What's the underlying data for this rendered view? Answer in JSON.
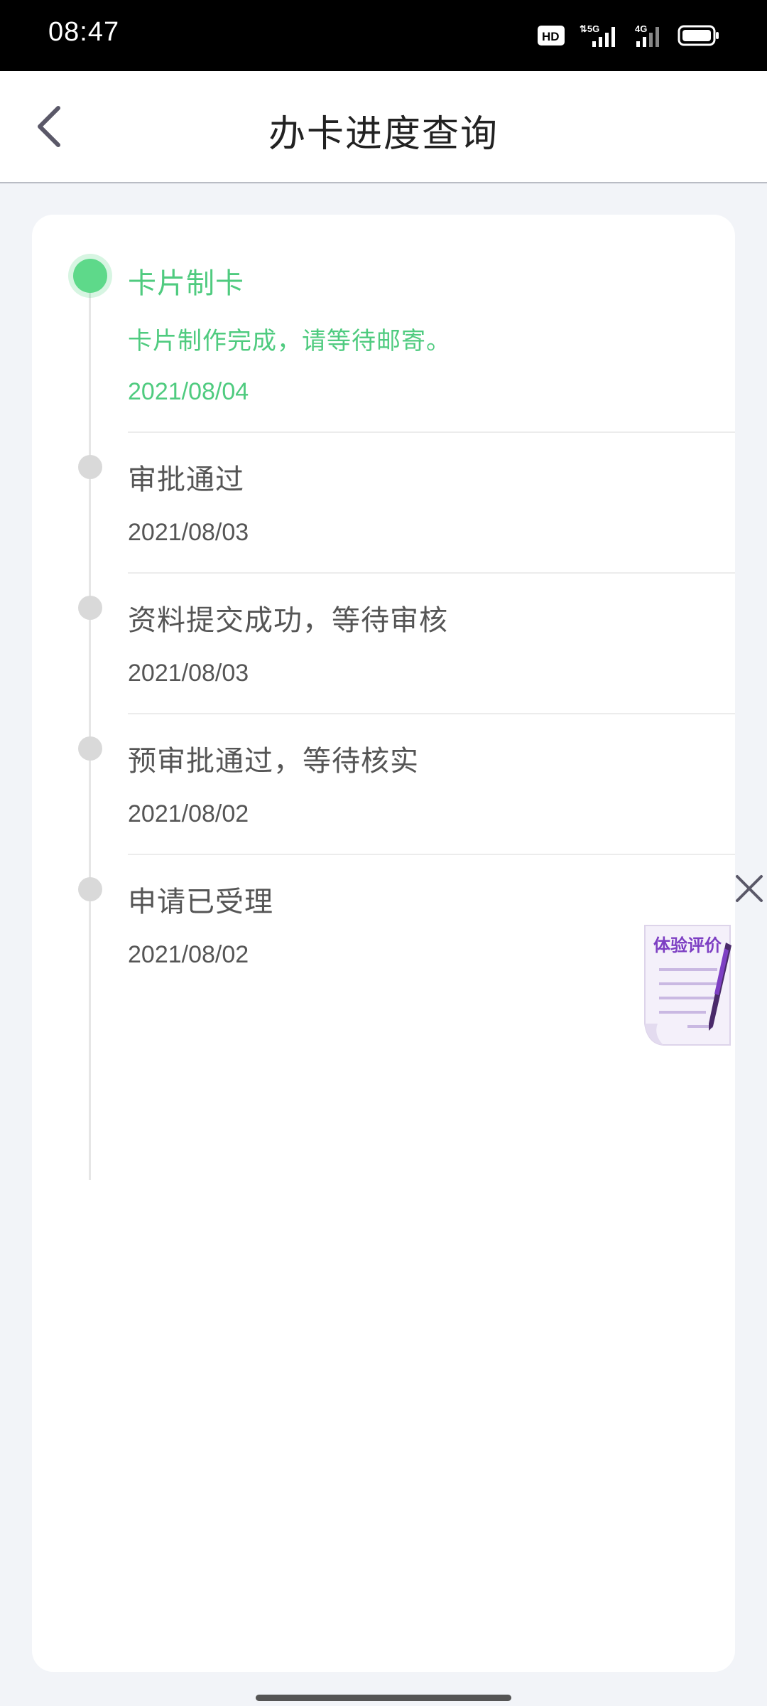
{
  "status_bar": {
    "time": "08:47",
    "hd_badge": "HD",
    "network_1": "5G",
    "network_2": "4G"
  },
  "nav": {
    "title": "办卡进度查询",
    "back_icon": "chevron-left-icon"
  },
  "steps": [
    {
      "title": "卡片制卡",
      "desc": "卡片制作完成，请等待邮寄。",
      "date": "2021/08/04",
      "active": true
    },
    {
      "title": "审批通过",
      "date": "2021/08/03",
      "active": false
    },
    {
      "title": "资料提交成功，等待审核",
      "date": "2021/08/03",
      "active": false
    },
    {
      "title": "预审批通过，等待核实",
      "date": "2021/08/02",
      "active": false
    },
    {
      "title": "申请已受理",
      "date": "2021/08/02",
      "active": false
    }
  ],
  "floating": {
    "review_label": "体验评价",
    "close_icon": "close-icon",
    "review_icon": "document-pen-icon"
  },
  "colors": {
    "accent_green": "#4fcb7f",
    "inactive_dot": "#d9d9d9",
    "review_purple": "#7d3fc3"
  }
}
